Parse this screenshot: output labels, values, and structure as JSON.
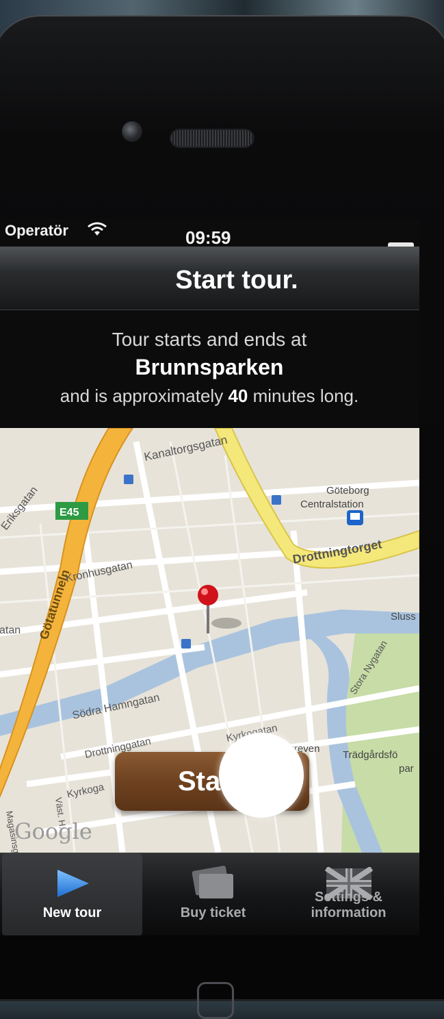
{
  "status_bar": {
    "carrier": "Operatör",
    "time": "09:59"
  },
  "nav": {
    "title": "Start tour."
  },
  "intro": {
    "line1": "Tour starts and ends at",
    "place": "Brunnsparken",
    "line3_prefix": "and is approximately",
    "duration_minutes": "40",
    "line3_suffix": "minutes long."
  },
  "map": {
    "labels": {
      "kanaltorgsgatan": "Kanaltorgsgatan",
      "eriksgatan": "Eriksgatan",
      "e45": "E45",
      "gotatunneln": "Götatunneln",
      "kronhusgatan": "Kronhusgatan",
      "goteborg": "Göteborg",
      "centralstation": "Centralstation",
      "drottningtorget": "Drottningtorget",
      "sluss": "Sluss",
      "gatan": "atan",
      "sodra_hamngatan": "Södra Hamngatan",
      "drottninggatan": "Drottninggatan",
      "kyrkogatan": "Kyrkogatan",
      "kyrkogatan2": "Kyrkoga",
      "stora_nygatan": "Stora Nygatan",
      "valgreven": "Valgreven",
      "tradgardsforen": "Trädgårdsfö",
      "park": "par",
      "magasinsgatan": "Magasinsg",
      "vasagatan": "Väst. H.",
      "google": "Google"
    }
  },
  "start_button": {
    "label": "Sta"
  },
  "tabs": {
    "new_tour": "New tour",
    "buy_ticket": "Buy ticket",
    "settings": "Settings & information"
  },
  "colors": {
    "accent_brown": "#6e4220",
    "pin_red": "#d0121b",
    "tab_blue": "#3d8ee0"
  }
}
